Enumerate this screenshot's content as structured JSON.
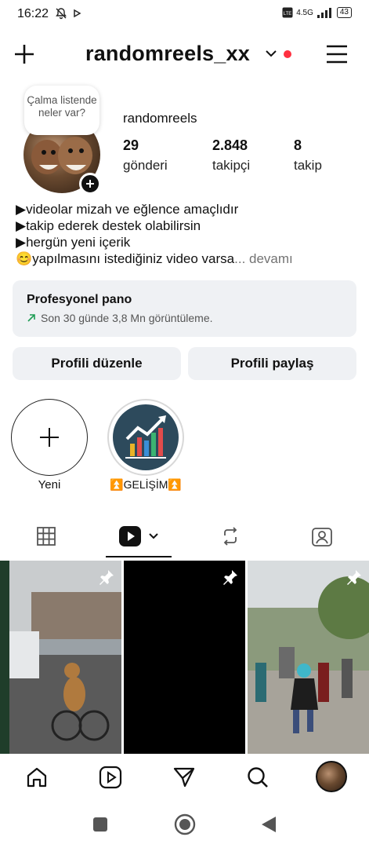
{
  "status_bar": {
    "time": "16:22",
    "network": "4.5G",
    "battery": "43"
  },
  "header": {
    "username": "randomreels_xx"
  },
  "profile": {
    "note": "Çalma listende neler var?",
    "name": "randomreels",
    "stats": [
      {
        "value": "29",
        "label": "gönderi"
      },
      {
        "value": "2.848",
        "label": "takipçi"
      },
      {
        "value": "8",
        "label": "takip"
      }
    ],
    "bio": [
      "▶videolar mizah ve eğlence amaçlıdır",
      "▶takip ederek destek olabilirsin",
      "▶hergün yeni içerik",
      "😊yapılmasını istediğiniz video varsa"
    ],
    "bio_more": "... devamı"
  },
  "dashboard": {
    "title": "Profesyonel pano",
    "subtitle": "Son 30 günde 3,8 Mn görüntüleme."
  },
  "buttons": {
    "edit": "Profili düzenle",
    "share": "Profili paylaş"
  },
  "highlights": [
    {
      "label": "Yeni",
      "icon": "plus-icon"
    },
    {
      "label": "⏫GELİŞİM⏫",
      "icon": "growth-chart"
    }
  ],
  "tabs": [
    {
      "icon": "grid-icon"
    },
    {
      "icon": "reels-icon"
    },
    {
      "icon": "repost-icon"
    },
    {
      "icon": "tagged-icon"
    }
  ],
  "nav": [
    {
      "icon": "home-icon"
    },
    {
      "icon": "reels-icon"
    },
    {
      "icon": "messages-icon"
    },
    {
      "icon": "search-icon"
    },
    {
      "icon": "profile-avatar"
    }
  ],
  "colors": {
    "notification_dot": "#ff3040",
    "card_bg": "#eff1f4",
    "link_green": "#1f9d55"
  }
}
